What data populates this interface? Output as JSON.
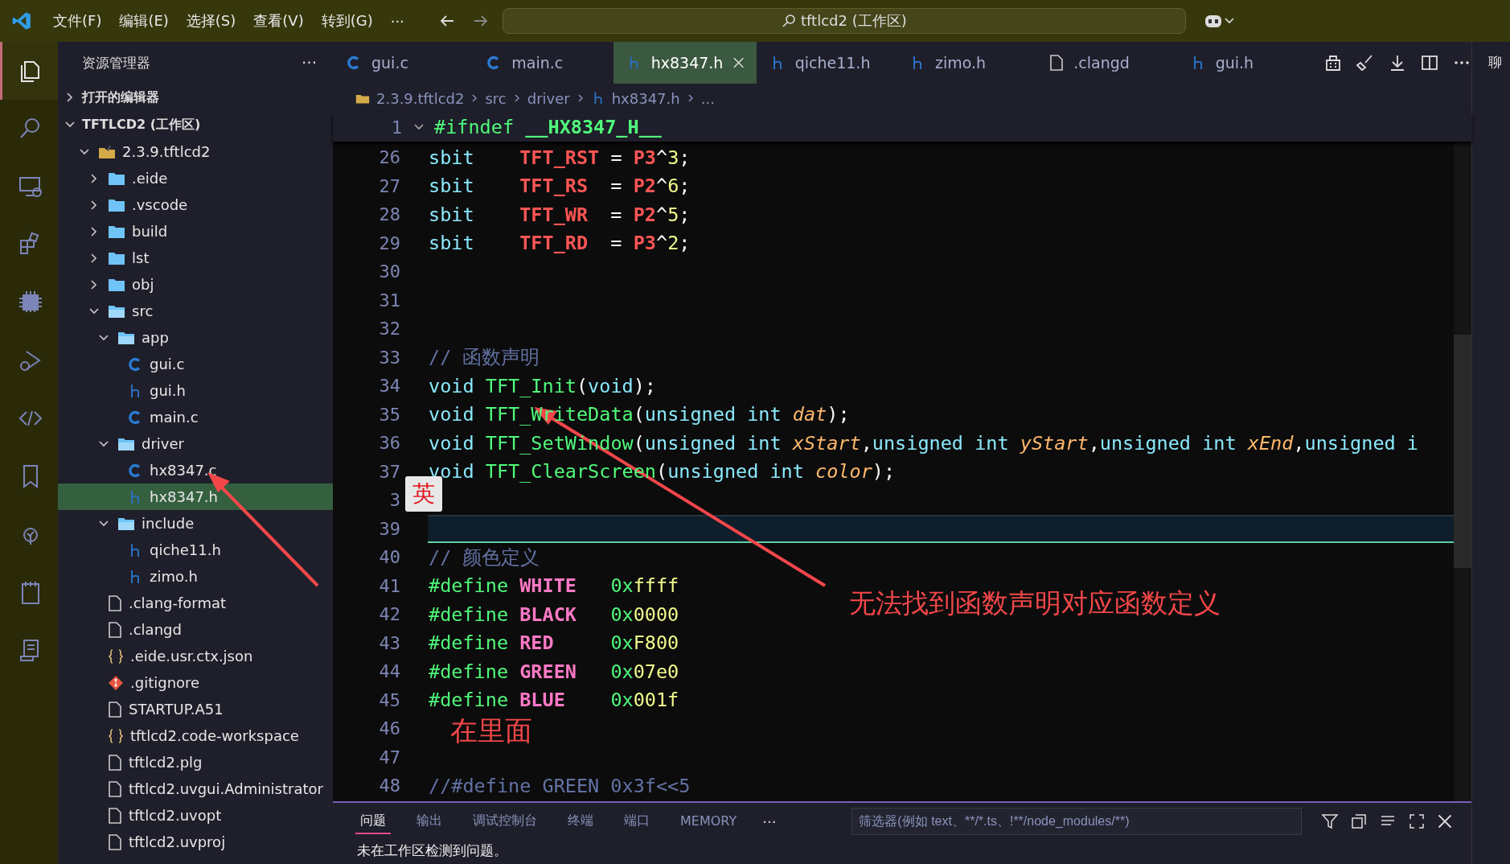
{
  "title_bar": {
    "menus": [
      "文件(F)",
      "编辑(E)",
      "选择(S)",
      "查看(V)",
      "转到(G)"
    ],
    "more": "···",
    "search": "tftlcd2 (工作区)"
  },
  "activity_bar": {
    "items": [
      {
        "selected": true
      },
      {
        "selected": false
      },
      {
        "selected": false
      },
      {
        "selected": false
      },
      {
        "selected": false
      },
      {
        "selected": false
      },
      {
        "selected": false
      },
      {
        "selected": false
      },
      {
        "selected": false
      },
      {
        "selected": false
      },
      {
        "selected": false
      }
    ]
  },
  "sidebar": {
    "title": "资源管理器",
    "more": "···",
    "sections": [
      {
        "title": "打开的编辑器",
        "expanded": false
      },
      {
        "title": "TFTLCD2 (工作区)",
        "expanded": true
      }
    ],
    "tree": [
      {
        "label": "2.3.9.tftlcd2",
        "kind": "root",
        "expanded": true,
        "selected": false,
        "children": [
          {
            "label": ".eide",
            "kind": "folder",
            "expanded": false,
            "selected": false
          },
          {
            "label": ".vscode",
            "kind": "folder",
            "expanded": false,
            "selected": false
          },
          {
            "label": "build",
            "kind": "folder",
            "expanded": false,
            "selected": false
          },
          {
            "label": "lst",
            "kind": "folder",
            "expanded": false,
            "selected": false
          },
          {
            "label": "obj",
            "kind": "folder",
            "expanded": false,
            "selected": false
          },
          {
            "label": "src",
            "kind": "folder",
            "expanded": true,
            "selected": false,
            "children": [
              {
                "label": "app",
                "kind": "folder",
                "expanded": true,
                "selected": false,
                "children": [
                  {
                    "label": "gui.c",
                    "kind": "c",
                    "selected": false
                  },
                  {
                    "label": "gui.h",
                    "kind": "h",
                    "selected": false
                  },
                  {
                    "label": "main.c",
                    "kind": "c",
                    "selected": false
                  }
                ]
              },
              {
                "label": "driver",
                "kind": "folder",
                "expanded": true,
                "selected": false,
                "children": [
                  {
                    "label": "hx8347.c",
                    "kind": "c",
                    "selected": false
                  },
                  {
                    "label": "hx8347.h",
                    "kind": "h",
                    "selected": true
                  }
                ]
              },
              {
                "label": "include",
                "kind": "folder",
                "expanded": true,
                "selected": false,
                "children": [
                  {
                    "label": "qiche11.h",
                    "kind": "h",
                    "selected": false
                  },
                  {
                    "label": "zimo.h",
                    "kind": "h",
                    "selected": false
                  }
                ]
              }
            ]
          },
          {
            "label": ".clang-format",
            "kind": "file",
            "selected": false
          },
          {
            "label": ".clangd",
            "kind": "file",
            "selected": false
          },
          {
            "label": ".eide.usr.ctx.json",
            "kind": "json",
            "selected": false
          },
          {
            "label": ".gitignore",
            "kind": "git",
            "selected": false
          },
          {
            "label": "STARTUP.A51",
            "kind": "file",
            "selected": false
          },
          {
            "label": "tftlcd2.code-workspace",
            "kind": "json",
            "selected": false
          },
          {
            "label": "tftlcd2.plg",
            "kind": "file",
            "selected": false
          },
          {
            "label": "tftlcd2.uvgui.Administrator",
            "kind": "file",
            "selected": false
          },
          {
            "label": "tftlcd2.uvopt",
            "kind": "file",
            "selected": false
          },
          {
            "label": "tftlcd2.uvproj",
            "kind": "file",
            "selected": false
          }
        ]
      }
    ]
  },
  "tabs": [
    {
      "label": "gui.c",
      "kind": "c",
      "selected": false
    },
    {
      "label": "main.c",
      "kind": "c",
      "selected": false
    },
    {
      "label": "hx8347.h",
      "kind": "h",
      "selected": true
    },
    {
      "label": "qiche11.h",
      "kind": "h",
      "selected": false
    },
    {
      "label": "zimo.h",
      "kind": "h",
      "selected": false
    },
    {
      "label": ".clangd",
      "kind": "file",
      "selected": false
    },
    {
      "label": "gui.h",
      "kind": "h",
      "selected": false
    }
  ],
  "breadcrumb": [
    {
      "label": "2.3.9.tftlcd2",
      "kind": "root"
    },
    {
      "label": "src",
      "kind": "text"
    },
    {
      "label": "driver",
      "kind": "text"
    },
    {
      "label": "hx8347.h",
      "kind": "h"
    },
    {
      "label": "...",
      "kind": "text"
    }
  ],
  "editor": {
    "sticky": {
      "number": "1",
      "tokens": [
        {
          "kind": "pp",
          "s": "#ifndef "
        },
        {
          "kind": "ppb",
          "s": "__HX8347_H__"
        }
      ]
    },
    "lines": [
      {
        "number": "26",
        "current": false,
        "tokens": [
          {
            "kind": "kw",
            "s": "sbit    "
          },
          {
            "kind": "mac",
            "s": "TFT_RST"
          },
          {
            "kind": "pl",
            "s": " = "
          },
          {
            "kind": "mac",
            "s": "P3"
          },
          {
            "kind": "pl",
            "s": "^"
          },
          {
            "kind": "num",
            "s": "3"
          },
          {
            "kind": "pl",
            "s": ";"
          }
        ]
      },
      {
        "number": "27",
        "current": false,
        "tokens": [
          {
            "kind": "kw",
            "s": "sbit    "
          },
          {
            "kind": "mac",
            "s": "TFT_RS"
          },
          {
            "kind": "pl",
            "s": "  = "
          },
          {
            "kind": "mac",
            "s": "P2"
          },
          {
            "kind": "pl",
            "s": "^"
          },
          {
            "kind": "num",
            "s": "6"
          },
          {
            "kind": "pl",
            "s": ";"
          }
        ]
      },
      {
        "number": "28",
        "current": false,
        "tokens": [
          {
            "kind": "kw",
            "s": "sbit    "
          },
          {
            "kind": "mac",
            "s": "TFT_WR"
          },
          {
            "kind": "pl",
            "s": "  = "
          },
          {
            "kind": "mac",
            "s": "P2"
          },
          {
            "kind": "pl",
            "s": "^"
          },
          {
            "kind": "num",
            "s": "5"
          },
          {
            "kind": "pl",
            "s": ";"
          }
        ]
      },
      {
        "number": "29",
        "current": false,
        "tokens": [
          {
            "kind": "kw",
            "s": "sbit    "
          },
          {
            "kind": "mac",
            "s": "TFT_RD"
          },
          {
            "kind": "pl",
            "s": "  = "
          },
          {
            "kind": "mac",
            "s": "P3"
          },
          {
            "kind": "pl",
            "s": "^"
          },
          {
            "kind": "num",
            "s": "2"
          },
          {
            "kind": "pl",
            "s": ";"
          }
        ]
      },
      {
        "number": "30",
        "current": false
      },
      {
        "number": "31",
        "current": false
      },
      {
        "number": "32",
        "current": false
      },
      {
        "number": "33",
        "current": false,
        "tokens": [
          {
            "kind": "com",
            "s": "// 函数声明"
          }
        ]
      },
      {
        "number": "34",
        "current": false,
        "tokens": [
          {
            "kind": "kw",
            "s": "void "
          },
          {
            "kind": "fn",
            "s": "TFT_Init"
          },
          {
            "kind": "pl",
            "s": "("
          },
          {
            "kind": "kw",
            "s": "void"
          },
          {
            "kind": "pl",
            "s": ");"
          }
        ]
      },
      {
        "number": "35",
        "current": false,
        "tokens": [
          {
            "kind": "kw",
            "s": "void "
          },
          {
            "kind": "fn",
            "s": "TFT_WriteData"
          },
          {
            "kind": "pl",
            "s": "("
          },
          {
            "kind": "kw",
            "s": "unsigned int "
          },
          {
            "kind": "par",
            "s": "dat"
          },
          {
            "kind": "pl",
            "s": ");"
          }
        ]
      },
      {
        "number": "36",
        "current": false,
        "tokens": [
          {
            "kind": "kw",
            "s": "void "
          },
          {
            "kind": "fn",
            "s": "TFT_SetWindow"
          },
          {
            "kind": "pl",
            "s": "("
          },
          {
            "kind": "kw",
            "s": "unsigned int "
          },
          {
            "kind": "par",
            "s": "xStart"
          },
          {
            "kind": "pl",
            "s": ","
          },
          {
            "kind": "kw",
            "s": "unsigned int "
          },
          {
            "kind": "par",
            "s": "yStart"
          },
          {
            "kind": "pl",
            "s": ","
          },
          {
            "kind": "kw",
            "s": "unsigned int "
          },
          {
            "kind": "par",
            "s": "xEnd"
          },
          {
            "kind": "pl",
            "s": ","
          },
          {
            "kind": "kw",
            "s": "unsigned i"
          }
        ]
      },
      {
        "number": "37",
        "current": false,
        "tokens": [
          {
            "kind": "kw",
            "s": "void "
          },
          {
            "kind": "fn",
            "s": "TFT_ClearScreen"
          },
          {
            "kind": "pl",
            "s": "("
          },
          {
            "kind": "kw",
            "s": "unsigned int "
          },
          {
            "kind": "par",
            "s": "color"
          },
          {
            "kind": "pl",
            "s": ");"
          }
        ]
      },
      {
        "number": "3",
        "current": false
      },
      {
        "number": "39",
        "current": true
      },
      {
        "number": "40",
        "current": false,
        "tokens": [
          {
            "kind": "com",
            "s": "// 颜色定义"
          }
        ]
      },
      {
        "number": "41",
        "current": false,
        "tokens": [
          {
            "kind": "pp",
            "s": "#define "
          },
          {
            "kind": "name",
            "s": "WHITE   "
          },
          {
            "kind": "pp",
            "s": "0x"
          },
          {
            "kind": "num",
            "s": "ffff"
          }
        ]
      },
      {
        "number": "42",
        "current": false,
        "tokens": [
          {
            "kind": "pp",
            "s": "#define "
          },
          {
            "kind": "name",
            "s": "BLACK   "
          },
          {
            "kind": "pp",
            "s": "0x"
          },
          {
            "kind": "num",
            "s": "0000"
          }
        ]
      },
      {
        "number": "43",
        "current": false,
        "tokens": [
          {
            "kind": "pp",
            "s": "#define "
          },
          {
            "kind": "name",
            "s": "RED     "
          },
          {
            "kind": "pp",
            "s": "0x"
          },
          {
            "kind": "num",
            "s": "F800"
          }
        ]
      },
      {
        "number": "44",
        "current": false,
        "tokens": [
          {
            "kind": "pp",
            "s": "#define "
          },
          {
            "kind": "name",
            "s": "GREEN   "
          },
          {
            "kind": "pp",
            "s": "0x"
          },
          {
            "kind": "num",
            "s": "07e0"
          }
        ]
      },
      {
        "number": "45",
        "current": false,
        "tokens": [
          {
            "kind": "pp",
            "s": "#define "
          },
          {
            "kind": "name",
            "s": "BLUE    "
          },
          {
            "kind": "pp",
            "s": "0x"
          },
          {
            "kind": "num",
            "s": "001f"
          }
        ]
      },
      {
        "number": "46",
        "current": false
      },
      {
        "number": "47",
        "current": false
      },
      {
        "number": "48",
        "current": false,
        "tokens": [
          {
            "kind": "com",
            "s": "//#define GREEN 0x3f<<5"
          }
        ]
      }
    ],
    "ime_badge": "英"
  },
  "annotations": [
    {
      "text": "在里面"
    },
    {
      "text": "无法找到函数声明对应函数定义"
    }
  ],
  "panel": {
    "tabs": [
      {
        "label": "问题",
        "selected": true
      },
      {
        "label": "输出",
        "selected": false
      },
      {
        "label": "调试控制台",
        "selected": false
      },
      {
        "label": "终端",
        "selected": false
      },
      {
        "label": "端口",
        "selected": false
      },
      {
        "label": "MEMORY",
        "selected": false
      }
    ],
    "more": "···",
    "filter_placeholder": "筛选器(例如 text、**/*.ts、!**/node_modules/**)",
    "message": "未在工作区检测到问题。"
  },
  "right_panel": {
    "label": "聊"
  }
}
